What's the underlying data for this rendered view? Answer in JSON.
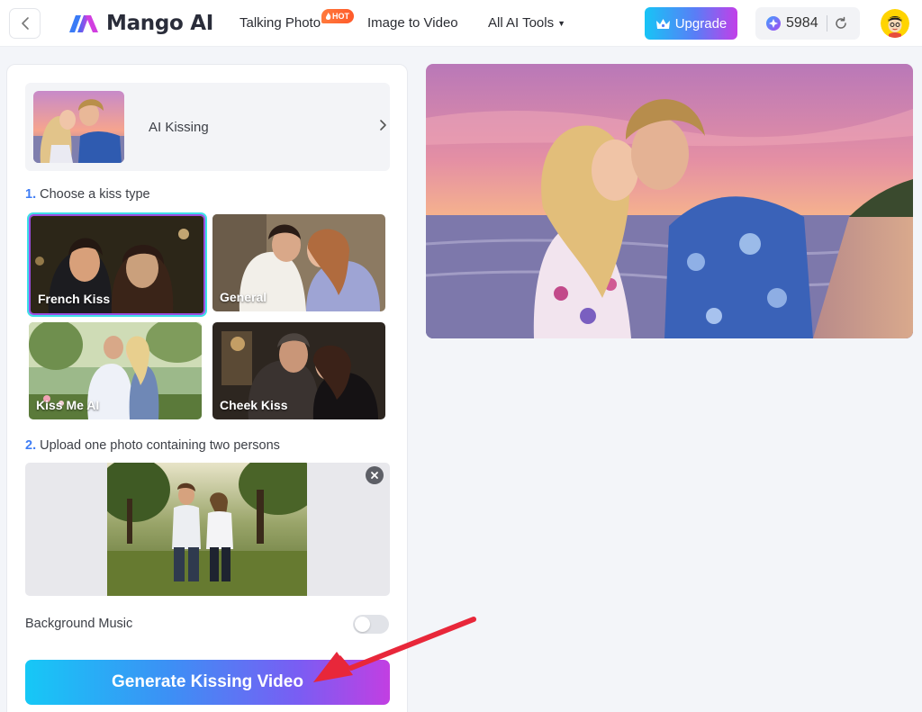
{
  "header": {
    "logo_text": "Mango AI",
    "nav": {
      "talking_photo": "Talking Photo",
      "hot_badge": "HOT",
      "image_to_video": "Image to Video",
      "all_ai_tools": "All AI Tools"
    },
    "upgrade_label": "Upgrade",
    "credits": "5984"
  },
  "template": {
    "label": "AI Kissing"
  },
  "step1": {
    "number": "1.",
    "title": "Choose a kiss type",
    "options": [
      {
        "label": "French Kiss",
        "selected": true
      },
      {
        "label": "General",
        "selected": false
      },
      {
        "label": "Kiss Me AI",
        "selected": false
      },
      {
        "label": "Cheek Kiss",
        "selected": false
      }
    ]
  },
  "step2": {
    "number": "2.",
    "title": "Upload one photo containing two persons"
  },
  "background_music": {
    "label": "Background Music",
    "enabled": false
  },
  "generate_label": "Generate Kissing Video",
  "colors": {
    "accent": "#3f7df5",
    "selected_border": "#9b4de0",
    "annotation": "#e8273a"
  }
}
